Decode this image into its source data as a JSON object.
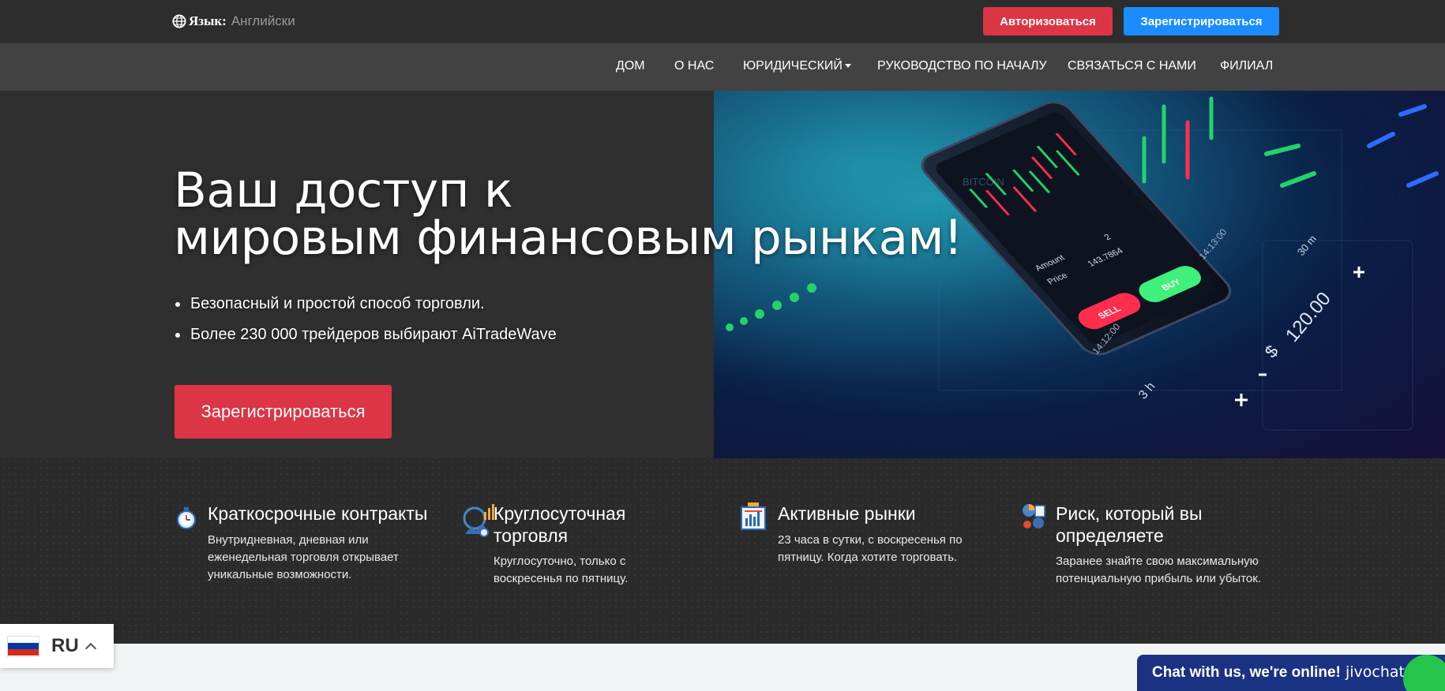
{
  "topbar": {
    "language_label": "Язык:",
    "language_value": "Английский",
    "login_label": "Авторизоваться",
    "register_label": "Зарегистрироваться",
    "colors": {
      "login": "#dc3545",
      "register": "#1a8cff",
      "background": "#2d2d2d"
    }
  },
  "nav": {
    "items": [
      {
        "label": "ДОМ"
      },
      {
        "label": "О НАС"
      },
      {
        "label": "ЮРИДИЧЕСКИЙ",
        "has_dropdown": true
      },
      {
        "label": "РУКОВОДСТВО ПО НАЧАЛУ"
      },
      {
        "label": "СВЯЗАТЬСЯ С НАМИ"
      },
      {
        "label": "ФИЛИАЛ"
      }
    ]
  },
  "hero": {
    "title_line1": "Ваш доступ к",
    "title_line2": "мировым финансовым рынкам!",
    "bullets": [
      "Безопасный и простой способ торговли.",
      "Более 230 000 трейдеров выбирают AiTradeWave"
    ],
    "cta_label": "Зарегистрироваться",
    "image": {
      "description_icon": "trading-phone-image",
      "phone": {
        "amount_label": "Amount",
        "amount_value": "2",
        "price_label": "Price",
        "price_value": "143.7864",
        "sell_label": "SELL",
        "buy_label": "BUY"
      },
      "overlay_texts": [
        "BITCOIN",
        "14:13:00",
        "14:12:00",
        "120.00",
        "$",
        "3 h",
        "30 m"
      ]
    }
  },
  "features": [
    {
      "icon": "stopwatch-icon",
      "title": "Краткосрочные контракты",
      "desc_lines": [
        "Внутридневная, дневная или",
        "еженедельная торговля открывает",
        "уникальные возможности."
      ]
    },
    {
      "icon": "clock-chart-icon",
      "title_lines": [
        "Круглосуточная",
        "торговля"
      ],
      "desc_lines": [
        "Круглосуточно, только с",
        "воскресенья по пятницу."
      ]
    },
    {
      "icon": "market-chart-icon",
      "title": "Активные рынки",
      "desc_lines": [
        "23 часа в сутки, с воскресенья по",
        "пятницу. Когда хотите торговать."
      ]
    },
    {
      "icon": "risk-analytics-icon",
      "title_lines": [
        "Риск, который вы",
        "определяете"
      ],
      "desc_lines": [
        "Заранее знайте свою максимальную",
        "потенциальную прибыль или убыток."
      ]
    }
  ],
  "language_switcher": {
    "code": "RU",
    "flag": "russia-flag-icon"
  },
  "chat": {
    "text": "Chat with us, we're online!",
    "brand": "jivochat",
    "color": "#1b3283"
  }
}
